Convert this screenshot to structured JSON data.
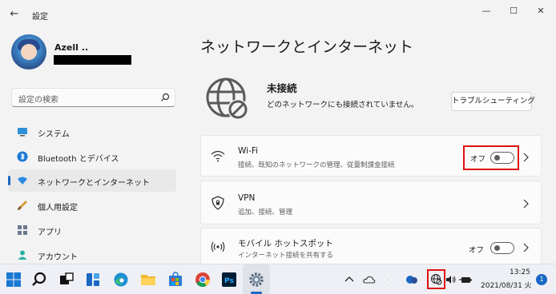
{
  "window": {
    "title": "設定",
    "back_glyph": "←",
    "minimize_glyph": "—",
    "maximize_glyph": "☐",
    "close_glyph": "✕"
  },
  "user": {
    "name": "Azell .."
  },
  "search": {
    "placeholder": "設定の検索"
  },
  "sidebar": {
    "items": [
      {
        "label": "システム",
        "icon": "monitor-icon"
      },
      {
        "label": "Bluetooth とデバイス",
        "icon": "bluetooth-icon"
      },
      {
        "label": "ネットワークとインターネット",
        "icon": "wifi-diamond-icon",
        "active": true
      },
      {
        "label": "個人用設定",
        "icon": "brush-icon"
      },
      {
        "label": "アプリ",
        "icon": "apps-icon"
      },
      {
        "label": "アカウント",
        "icon": "person-icon"
      }
    ]
  },
  "main": {
    "title": "ネットワークとインターネット",
    "status_title": "未接続",
    "status_desc": "どのネットワークにも接続されていません。",
    "troubleshoot_label": "トラブルシューティング",
    "cards": [
      {
        "title": "Wi-Fi",
        "sub": "接続、既知のネットワークの管理、従量制課金接続",
        "toggle_label": "オフ",
        "toggle_on": false
      },
      {
        "title": "VPN",
        "sub": "追加、接続、管理"
      },
      {
        "title": "モバイル ホットスポット",
        "sub": "インターネット接続を共有する",
        "toggle_label": "オフ",
        "toggle_on": false
      }
    ]
  },
  "taskbar": {
    "time": "13:25",
    "date": "2021/08/31 火",
    "notification_count": "1"
  },
  "colors": {
    "accent": "#1a67c4",
    "highlight": "#e01010"
  }
}
